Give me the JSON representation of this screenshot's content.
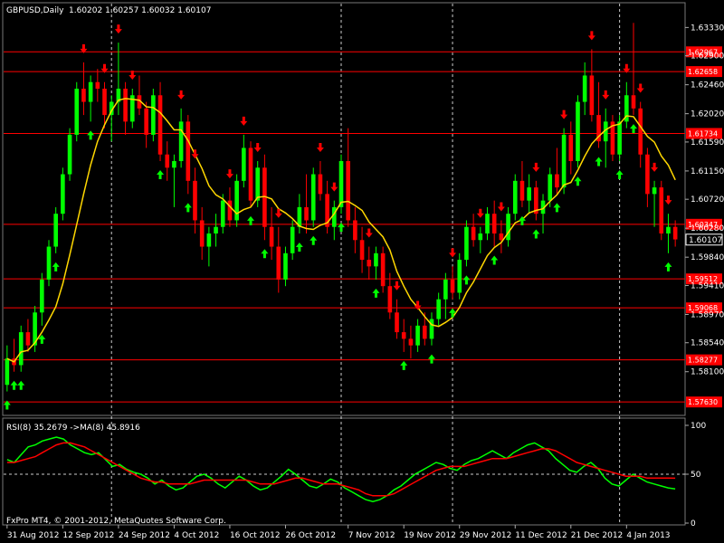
{
  "header": {
    "symbol": "GBPUSD,Daily",
    "ohlc": "1.60202 1.60257 1.60032 1.60107"
  },
  "footer": {
    "copyright": "FxPro MT4, © 2001-2012, MetaQuotes Software Corp."
  },
  "colors": {
    "background": "#000000",
    "bull": "#00ff00",
    "bear": "#ff0000",
    "ma_price": "#ffd700",
    "rsi": "#00ff00",
    "rsi_ma": "#ff0000",
    "hline": "#ff0000",
    "grid": "#ffffff",
    "current_price_box": "#000000"
  },
  "chart_data": [
    {
      "type": "candlestick",
      "title": "GBPUSD,Daily",
      "ylim": [
        1.5745,
        1.635
      ],
      "y_ticks": [
        "1.63330",
        "1.62900",
        "1.62460",
        "1.62020",
        "1.61590",
        "1.61150",
        "1.60720",
        "1.60280",
        "1.59840",
        "1.59410",
        "1.58970",
        "1.58540",
        "1.58100"
      ],
      "x_labels": [
        "31 Aug 2012",
        "12 Sep 2012",
        "24 Sep 2012",
        "4 Oct 2012",
        "16 Oct 2012",
        "26 Oct 2012",
        "7 Nov 2012",
        "19 Nov 2012",
        "29 Nov 2012",
        "11 Dec 2012",
        "21 Dec 2012",
        "4 Jan 2013"
      ],
      "vertical_grid_after_label_index": [
        1,
        5,
        7,
        10
      ],
      "current_price": "1.60107",
      "horizontal_levels": [
        {
          "value": 1.6296,
          "label": "1.62967"
        },
        {
          "value": 1.6266,
          "label": "1.62658"
        },
        {
          "value": 1.6172,
          "label": "1.61734"
        },
        {
          "value": 1.6034,
          "label": "1.60347"
        },
        {
          "value": 1.5951,
          "label": "1.59512"
        },
        {
          "value": 1.5907,
          "label": "1.59068"
        },
        {
          "value": 1.5828,
          "label": "1.58277"
        },
        {
          "value": 1.5764,
          "label": "1.57630"
        }
      ],
      "candles": [
        [
          1.579,
          1.585,
          1.578,
          1.583
        ],
        [
          1.583,
          1.586,
          1.581,
          1.582
        ],
        [
          1.582,
          1.588,
          1.581,
          1.587
        ],
        [
          1.587,
          1.589,
          1.584,
          1.585
        ],
        [
          1.585,
          1.591,
          1.584,
          1.59
        ],
        [
          1.59,
          1.596,
          1.588,
          1.595
        ],
        [
          1.595,
          1.601,
          1.594,
          1.6
        ],
        [
          1.6,
          1.606,
          1.599,
          1.605
        ],
        [
          1.605,
          1.612,
          1.604,
          1.611
        ],
        [
          1.611,
          1.618,
          1.61,
          1.617
        ],
        [
          1.617,
          1.625,
          1.616,
          1.624
        ],
        [
          1.624,
          1.628,
          1.62,
          1.622
        ],
        [
          1.622,
          1.626,
          1.619,
          1.625
        ],
        [
          1.625,
          1.627,
          1.622,
          1.624
        ],
        [
          1.624,
          1.625,
          1.618,
          1.62
        ],
        [
          1.62,
          1.623,
          1.616,
          1.622
        ],
        [
          1.622,
          1.631,
          1.62,
          1.624
        ],
        [
          1.624,
          1.625,
          1.617,
          1.619
        ],
        [
          1.619,
          1.624,
          1.618,
          1.623
        ],
        [
          1.623,
          1.626,
          1.62,
          1.621
        ],
        [
          1.621,
          1.622,
          1.615,
          1.617
        ],
        [
          1.617,
          1.624,
          1.616,
          1.623
        ],
        [
          1.623,
          1.625,
          1.613,
          1.614
        ],
        [
          1.614,
          1.616,
          1.61,
          1.612
        ],
        [
          1.612,
          1.614,
          1.606,
          1.613
        ],
        [
          1.613,
          1.621,
          1.612,
          1.619
        ],
        [
          1.619,
          1.62,
          1.608,
          1.61
        ],
        [
          1.61,
          1.612,
          1.602,
          1.604
        ],
        [
          1.604,
          1.606,
          1.598,
          1.6
        ],
        [
          1.6,
          1.603,
          1.597,
          1.602
        ],
        [
          1.602,
          1.605,
          1.6,
          1.603
        ],
        [
          1.603,
          1.608,
          1.602,
          1.607
        ],
        [
          1.607,
          1.609,
          1.603,
          1.604
        ],
        [
          1.604,
          1.611,
          1.603,
          1.61
        ],
        [
          1.61,
          1.617,
          1.609,
          1.615
        ],
        [
          1.615,
          1.616,
          1.606,
          1.607
        ],
        [
          1.607,
          1.613,
          1.606,
          1.612
        ],
        [
          1.612,
          1.614,
          1.601,
          1.603
        ],
        [
          1.603,
          1.606,
          1.598,
          1.6
        ],
        [
          1.6,
          1.603,
          1.593,
          1.595
        ],
        [
          1.595,
          1.6,
          1.594,
          1.599
        ],
        [
          1.599,
          1.604,
          1.598,
          1.603
        ],
        [
          1.603,
          1.608,
          1.602,
          1.606
        ],
        [
          1.606,
          1.611,
          1.602,
          1.604
        ],
        [
          1.604,
          1.612,
          1.603,
          1.611
        ],
        [
          1.611,
          1.613,
          1.607,
          1.608
        ],
        [
          1.608,
          1.61,
          1.602,
          1.603
        ],
        [
          1.603,
          1.607,
          1.601,
          1.606
        ],
        [
          1.606,
          1.614,
          1.605,
          1.613
        ],
        [
          1.613,
          1.618,
          1.603,
          1.604
        ],
        [
          1.604,
          1.606,
          1.599,
          1.601
        ],
        [
          1.601,
          1.603,
          1.596,
          1.598
        ],
        [
          1.598,
          1.6,
          1.595,
          1.597
        ],
        [
          1.597,
          1.6,
          1.595,
          1.599
        ],
        [
          1.599,
          1.6,
          1.593,
          1.594
        ],
        [
          1.594,
          1.596,
          1.589,
          1.59
        ],
        [
          1.59,
          1.592,
          1.586,
          1.587
        ],
        [
          1.587,
          1.589,
          1.584,
          1.586
        ],
        [
          1.586,
          1.588,
          1.583,
          1.585
        ],
        [
          1.585,
          1.589,
          1.584,
          1.588
        ],
        [
          1.588,
          1.59,
          1.585,
          1.586
        ],
        [
          1.586,
          1.59,
          1.585,
          1.589
        ],
        [
          1.589,
          1.593,
          1.588,
          1.592
        ],
        [
          1.592,
          1.596,
          1.589,
          1.595
        ],
        [
          1.595,
          1.597,
          1.592,
          1.593
        ],
        [
          1.593,
          1.599,
          1.592,
          1.598
        ],
        [
          1.598,
          1.604,
          1.597,
          1.603
        ],
        [
          1.603,
          1.605,
          1.6,
          1.601
        ],
        [
          1.601,
          1.603,
          1.599,
          1.602
        ],
        [
          1.602,
          1.606,
          1.601,
          1.605
        ],
        [
          1.605,
          1.607,
          1.6,
          1.602
        ],
        [
          1.602,
          1.604,
          1.599,
          1.601
        ],
        [
          1.601,
          1.606,
          1.6,
          1.605
        ],
        [
          1.605,
          1.611,
          1.604,
          1.61
        ],
        [
          1.61,
          1.613,
          1.606,
          1.607
        ],
        [
          1.607,
          1.611,
          1.605,
          1.609
        ],
        [
          1.609,
          1.61,
          1.604,
          1.605
        ],
        [
          1.605,
          1.608,
          1.602,
          1.607
        ],
        [
          1.607,
          1.612,
          1.606,
          1.611
        ],
        [
          1.611,
          1.615,
          1.608,
          1.609
        ],
        [
          1.609,
          1.618,
          1.608,
          1.617
        ],
        [
          1.617,
          1.619,
          1.611,
          1.613
        ],
        [
          1.613,
          1.623,
          1.612,
          1.622
        ],
        [
          1.622,
          1.628,
          1.62,
          1.626
        ],
        [
          1.626,
          1.63,
          1.619,
          1.62
        ],
        [
          1.62,
          1.625,
          1.615,
          1.616
        ],
        [
          1.616,
          1.621,
          1.612,
          1.619
        ],
        [
          1.619,
          1.62,
          1.613,
          1.614
        ],
        [
          1.614,
          1.62,
          1.613,
          1.619
        ],
        [
          1.619,
          1.625,
          1.618,
          1.623
        ],
        [
          1.623,
          1.634,
          1.62,
          1.621
        ],
        [
          1.621,
          1.622,
          1.612,
          1.614
        ],
        [
          1.614,
          1.615,
          1.606,
          1.608
        ],
        [
          1.608,
          1.61,
          1.603,
          1.609
        ],
        [
          1.609,
          1.61,
          1.601,
          1.602
        ],
        [
          1.602,
          1.605,
          1.599,
          1.603
        ],
        [
          1.603,
          1.604,
          1.6,
          1.6011
        ]
      ],
      "ma_period_label": "MA",
      "up_arrows_at": [
        0,
        1,
        2,
        5,
        7,
        12,
        22,
        26,
        35,
        37,
        42,
        44,
        48,
        53,
        57,
        61,
        64,
        66,
        70,
        74,
        76,
        79,
        82,
        85,
        88,
        90,
        95
      ],
      "down_arrows_at": [
        11,
        14,
        16,
        18,
        25,
        27,
        32,
        34,
        36,
        39,
        45,
        47,
        52,
        56,
        59,
        64,
        68,
        71,
        76,
        80,
        84,
        86,
        89,
        91,
        93,
        95
      ]
    },
    {
      "type": "line",
      "title": "RSI(8) 35.2679  ->MA(8) 45.8916",
      "ylim": [
        0,
        100
      ],
      "y_ticks": [
        "100",
        "50",
        "0"
      ],
      "levels": [
        50
      ],
      "series": [
        {
          "name": "RSI(8) 35.2679",
          "values": [
            65,
            62,
            70,
            78,
            80,
            84,
            86,
            88,
            86,
            80,
            76,
            72,
            70,
            72,
            65,
            58,
            60,
            55,
            52,
            50,
            46,
            40,
            44,
            38,
            34,
            36,
            42,
            48,
            50,
            46,
            40,
            36,
            42,
            48,
            44,
            38,
            34,
            36,
            42,
            48,
            55,
            50,
            44,
            38,
            36,
            40,
            45,
            42,
            36,
            32,
            28,
            24,
            22,
            24,
            28,
            34,
            38,
            44,
            50,
            54,
            58,
            62,
            60,
            56,
            54,
            60,
            64,
            66,
            70,
            74,
            70,
            66,
            72,
            76,
            80,
            82,
            78,
            74,
            66,
            60,
            54,
            52,
            58,
            62,
            56,
            46,
            40,
            38,
            44,
            50,
            46,
            42,
            40,
            38,
            36,
            35
          ]
        },
        {
          "name": "->MA(8) 45.8916",
          "values": [
            62,
            62,
            64,
            66,
            68,
            72,
            76,
            80,
            82,
            82,
            80,
            78,
            74,
            70,
            66,
            62,
            58,
            54,
            50,
            46,
            44,
            42,
            42,
            40,
            40,
            40,
            40,
            42,
            44,
            44,
            44,
            44,
            44,
            44,
            44,
            42,
            40,
            40,
            40,
            42,
            44,
            46,
            46,
            44,
            42,
            40,
            40,
            40,
            38,
            36,
            34,
            30,
            28,
            28,
            28,
            30,
            34,
            38,
            42,
            46,
            50,
            54,
            56,
            58,
            58,
            58,
            60,
            62,
            64,
            66,
            66,
            66,
            68,
            70,
            72,
            74,
            76,
            76,
            74,
            70,
            66,
            62,
            60,
            58,
            56,
            54,
            52,
            50,
            48,
            48,
            48,
            46,
            46,
            46,
            46,
            45.9
          ]
        }
      ]
    }
  ]
}
